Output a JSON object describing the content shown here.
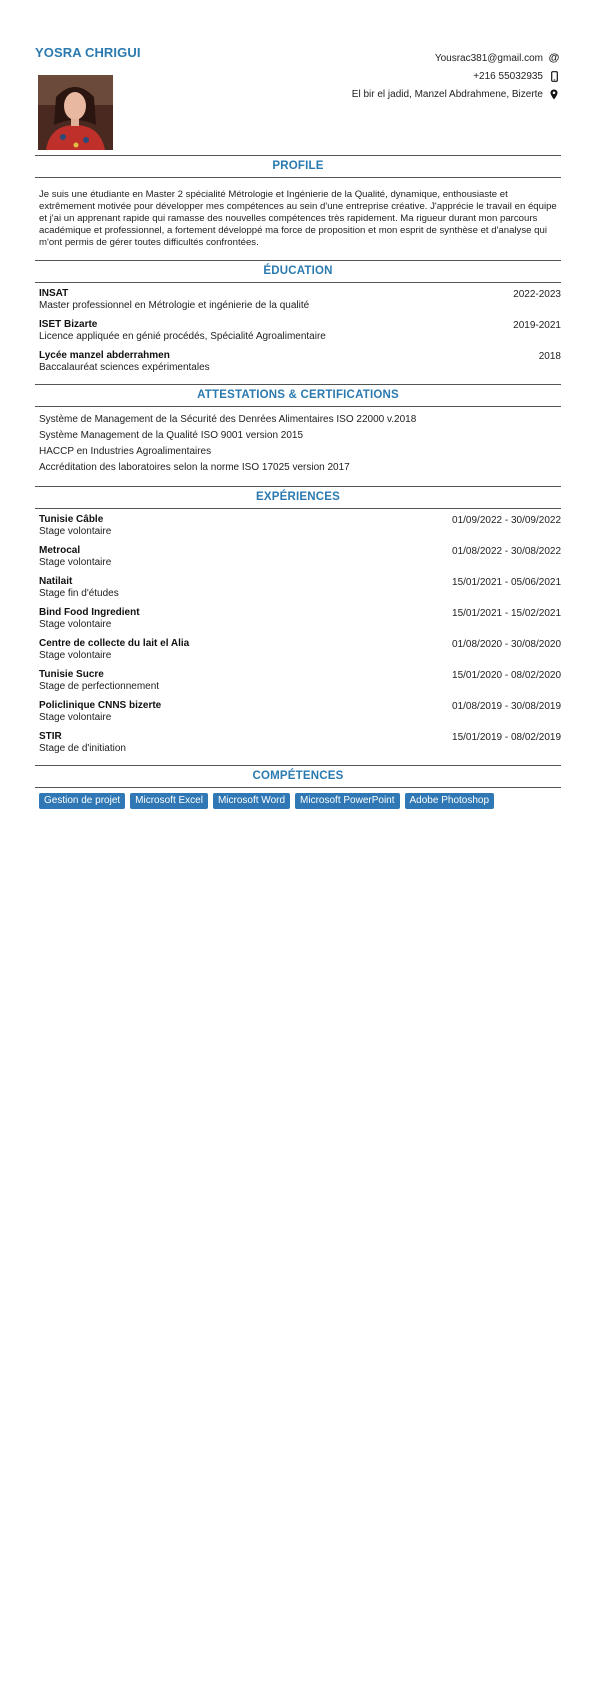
{
  "header": {
    "name": "YOSRA CHRIGUI",
    "email": "Yousrac381@gmail.com",
    "phone": "+216 55032935",
    "address": "El bir el jadid, Manzel Abdrahmene, Bizerte"
  },
  "profile": {
    "heading": "PROFILE",
    "text": "Je suis une étudiante en Master 2 spécialité Métrologie et Ingénierie de la Qualité, dynamique, enthousiaste et extrêmement motivée pour développer mes compétences au sein d'une entreprise créative. J'apprécie le travail en équipe et j'ai un apprenant rapide qui ramasse des nouvelles compétences très rapidement. Ma rigueur durant mon parcours académique et professionnel, a fortement développé ma force de proposition et mon esprit de synthèse et d'analyse qui m'ont permis de gérer toutes difficultés confrontées."
  },
  "education": {
    "heading": "ÉDUCATION",
    "items": [
      {
        "school": "INSAT",
        "degree": "Master professionnel en Métrologie et ingénierie de la qualité",
        "date": "2022-2023"
      },
      {
        "school": "ISET Bizarte",
        "degree": "Licence appliquée en génié procédés, Spécialité Agroalimentaire",
        "date": "2019-2021"
      },
      {
        "school": "Lycée manzel abderrahmen",
        "degree": "Baccalauréat sciences expérimentales",
        "date": "2018"
      }
    ]
  },
  "certifications": {
    "heading": "ATTESTATIONS & CERTIFICATIONS",
    "items": [
      "Système de Management de la Sécurité des Denrées Alimentaires ISO 22000 v.2018",
      "Système Management de la Qualité ISO 9001 version 2015",
      "HACCP en Industries Agroalimentaires",
      "Accréditation des laboratoires selon la norme ISO 17025 version 2017"
    ]
  },
  "experiences": {
    "heading": "EXPÉRIENCES",
    "items": [
      {
        "company": "Tunisie Câble",
        "role": "Stage volontaire",
        "date": "01/09/2022 - 30/09/2022"
      },
      {
        "company": "Metrocal",
        "role": "Stage volontaire",
        "date": "01/08/2022 - 30/08/2022"
      },
      {
        "company": "Natilait",
        "role": "Stage fin d'études",
        "date": "15/01/2021 - 05/06/2021"
      },
      {
        "company": "Bind Food Ingredient",
        "role": "Stage volontaire",
        "date": "15/01/2021 - 15/02/2021"
      },
      {
        "company": "Centre de collecte du lait el Alia",
        "role": "Stage volontaire",
        "date": "01/08/2020 - 30/08/2020"
      },
      {
        "company": "Tunisie Sucre",
        "role": "Stage de perfectionnement",
        "date": "15/01/2020 - 08/02/2020"
      },
      {
        "company": "Policlinique CNNS bizerte",
        "role": "Stage volontaire",
        "date": "01/08/2019 - 30/08/2019"
      },
      {
        "company": "STIR",
        "role": "Stage de d'initiation",
        "date": "15/01/2019 - 08/02/2019"
      }
    ]
  },
  "skills": {
    "heading": "COMPÉTENCES",
    "items": [
      "Gestion de projet",
      "Microsoft Excel",
      "Microsoft Word",
      "Microsoft PowerPoint",
      "Adobe Photoshop"
    ]
  }
}
